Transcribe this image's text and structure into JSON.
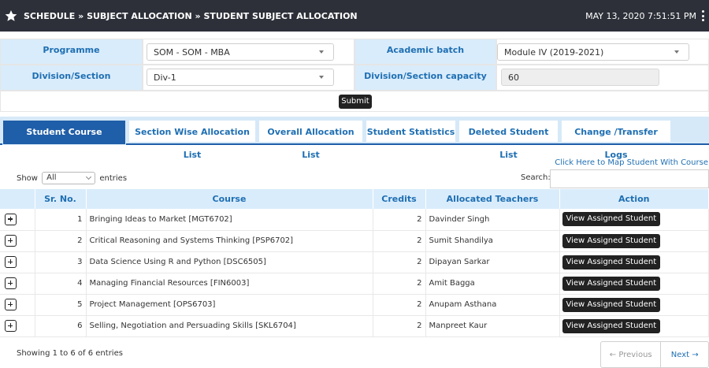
{
  "header": {
    "breadcrumb": "SCHEDULE » SUBJECT ALLOCATION » STUDENT SUBJECT ALLOCATION",
    "datetime": "MAY 13, 2020  7:51:51 PM"
  },
  "filters": {
    "programme_label": "Programme",
    "programme_value": "SOM - SOM - MBA",
    "batch_label": "Academic batch",
    "batch_value": "Module IV (2019-2021)",
    "division_label": "Division/Section",
    "division_value": "Div-1",
    "capacity_label": "Division/Section capacity",
    "capacity_value": "60",
    "submit_label": "Submit"
  },
  "tabs": [
    {
      "label": "Student Course Allocation",
      "active": true
    },
    {
      "label": "Section Wise Allocation List",
      "active": false
    },
    {
      "label": "Overall Allocation List",
      "active": false
    },
    {
      "label": "Student Statistics",
      "active": false
    },
    {
      "label": "Deleted Student List",
      "active": false
    },
    {
      "label": "Change /Transfer Logs",
      "active": false
    }
  ],
  "map_link": "Click Here to Map Student With Course",
  "length_menu": {
    "prefix": "Show",
    "value": "All",
    "suffix": "entries"
  },
  "search_label": "Search:",
  "table": {
    "columns": [
      "",
      "Sr. No.",
      "Course",
      "Credits",
      "Allocated Teachers",
      "Action"
    ],
    "action_label": "View Assigned Student",
    "rows": [
      {
        "sr": "1",
        "course": "Bringing Ideas to Market [MGT6702]",
        "credits": "2",
        "teacher": "Davinder Singh"
      },
      {
        "sr": "2",
        "course": "Critical Reasoning and Systems Thinking [PSP6702]",
        "credits": "2",
        "teacher": "Sumit Shandilya"
      },
      {
        "sr": "3",
        "course": "Data Science Using R and Python [DSC6505]",
        "credits": "2",
        "teacher": "Dipayan Sarkar"
      },
      {
        "sr": "4",
        "course": "Managing Financial Resources [FIN6003]",
        "credits": "2",
        "teacher": "Amit Bagga"
      },
      {
        "sr": "5",
        "course": "Project Management [OPS6703]",
        "credits": "2",
        "teacher": "Anupam Asthana"
      },
      {
        "sr": "6",
        "course": "Selling, Negotiation and Persuading Skills [SKL6704]",
        "credits": "2",
        "teacher": "Manpreet Kaur"
      }
    ]
  },
  "footer": {
    "showing": "Showing 1 to 6 of 6 entries",
    "prev_label": "← Previous",
    "next_label": "Next →"
  }
}
